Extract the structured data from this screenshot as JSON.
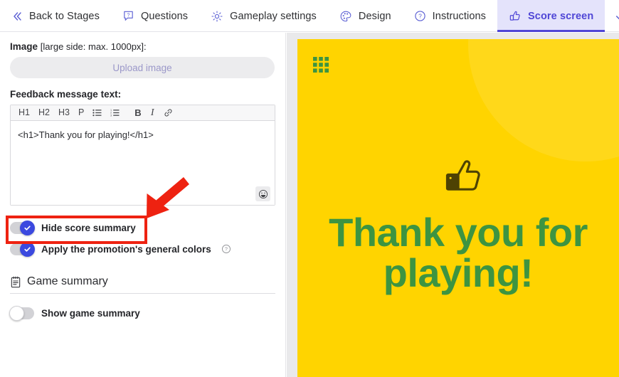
{
  "tabs": [
    {
      "label": "Back to Stages",
      "icon": "chevrons-left-icon",
      "name": "tab-back-to-stages",
      "active": false
    },
    {
      "label": "Questions",
      "icon": "question-bubble-icon",
      "name": "tab-questions",
      "active": false
    },
    {
      "label": "Gameplay settings",
      "icon": "gear-icon",
      "name": "tab-gameplay-settings",
      "active": false
    },
    {
      "label": "Design",
      "icon": "palette-icon",
      "name": "tab-design",
      "active": false
    },
    {
      "label": "Instructions",
      "icon": "question-circle-icon",
      "name": "tab-instructions",
      "active": false
    },
    {
      "label": "Score screen",
      "icon": "thumbs-up-icon",
      "name": "tab-score-screen",
      "active": true
    }
  ],
  "save_tab": {
    "icon": "checkmark-icon",
    "name": "tab-save-check"
  },
  "left_panel": {
    "image_label": "Image",
    "image_hint": "[large side: max. 1000px]:",
    "upload_button": "Upload image",
    "feedback_label": "Feedback message text:",
    "toolbar": [
      {
        "label": "H1",
        "name": "editor-h1-button"
      },
      {
        "label": "H2",
        "name": "editor-h2-button"
      },
      {
        "label": "H3",
        "name": "editor-h3-button"
      },
      {
        "label": "P",
        "name": "editor-paragraph-button"
      },
      {
        "label": "",
        "name": "editor-bullet-list-button",
        "icon": "bullet-list-icon"
      },
      {
        "label": "",
        "name": "editor-numbered-list-button",
        "icon": "numbered-list-icon"
      },
      {
        "label": "B",
        "name": "editor-bold-button"
      },
      {
        "label": "I",
        "name": "editor-italic-button"
      },
      {
        "label": "",
        "name": "editor-link-button",
        "icon": "link-icon"
      }
    ],
    "editor_value": "<h1>Thank you for playing!</h1>",
    "emoji_button_icon": "smiley-icon",
    "toggles": [
      {
        "label": "Hide score summary",
        "state": "on",
        "name": "toggle-hide-score-summary",
        "help": false
      },
      {
        "label": "Apply the promotion's general colors",
        "state": "on",
        "name": "toggle-apply-general-colors",
        "help": true
      }
    ],
    "game_summary": {
      "icon": "clipboard-icon",
      "title": "Game summary",
      "toggle": {
        "label": "Show game summary",
        "state": "off",
        "name": "toggle-show-game-summary"
      }
    }
  },
  "preview": {
    "background_color": "#ffd400",
    "grid_icon": "grid-3x3-icon",
    "thumbs_icon": "thumbs-up-icon",
    "message": "Thank you for playing!",
    "message_color": "#3d9441"
  },
  "annotation": {
    "highlight_color": "#ee2211",
    "arrow_icon": "arrow-down-left-icon",
    "highlight_target": "toggle-hide-score-summary"
  }
}
